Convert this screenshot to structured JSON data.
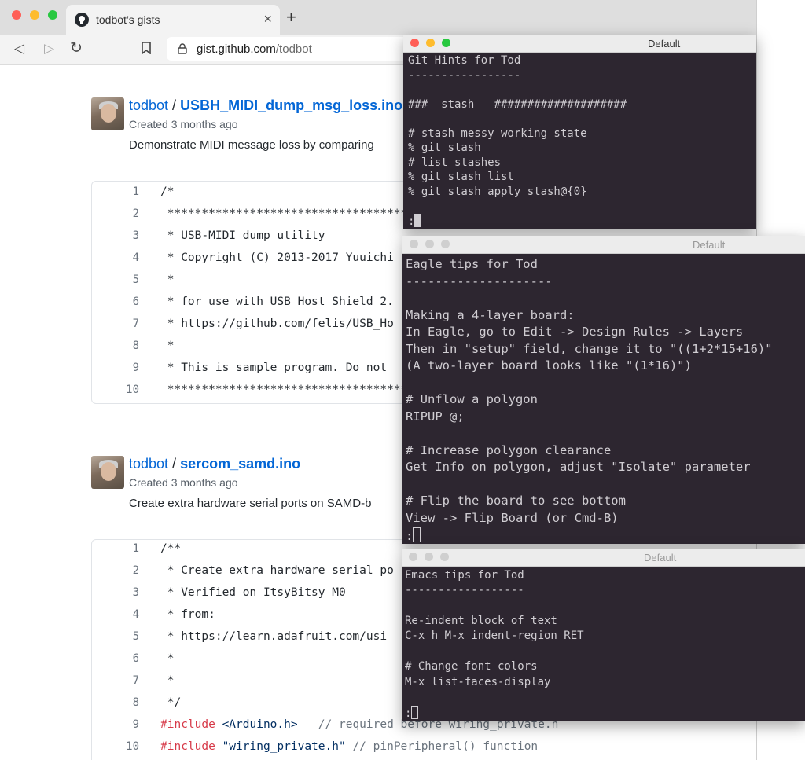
{
  "browser": {
    "tab_title": "todbot’s gists",
    "tab_close": "×",
    "new_tab": "+",
    "url_host": "gist.github.com",
    "url_path": "/todbot",
    "nav": {
      "back": "◁",
      "forward": "▷",
      "reload": "↻"
    }
  },
  "gists": [
    {
      "owner": "todbot",
      "sep": " / ",
      "name": "USBH_MIDI_dump_msg_loss.ino",
      "created": "Created 3 months ago",
      "description": "Demonstrate MIDI message loss by comparing",
      "lines": [
        {
          "n": "1",
          "text": "/*"
        },
        {
          "n": "2",
          "text": " *******************************************"
        },
        {
          "n": "3",
          "text": " * USB-MIDI dump utility"
        },
        {
          "n": "4",
          "text": " * Copyright (C) 2013-2017 Yuuichi"
        },
        {
          "n": "5",
          "text": " *"
        },
        {
          "n": "6",
          "text": " * for use with USB Host Shield 2."
        },
        {
          "n": "7",
          "text": " * https://github.com/felis/USB_Ho"
        },
        {
          "n": "8",
          "text": " *"
        },
        {
          "n": "9",
          "text": " * This is sample program. Do not"
        },
        {
          "n": "10",
          "text": " *******************************************"
        }
      ]
    },
    {
      "owner": "todbot",
      "sep": " / ",
      "name": "sercom_samd.ino",
      "created": "Created 3 months ago",
      "description": "Create extra hardware serial ports on SAMD-b",
      "lines": [
        {
          "n": "1",
          "text": "/**"
        },
        {
          "n": "2",
          "text": " * Create extra hardware serial po"
        },
        {
          "n": "3",
          "text": " * Verified on ItsyBitsy M0"
        },
        {
          "n": "4",
          "text": " * from:"
        },
        {
          "n": "5",
          "text": " * https://learn.adafruit.com/usi"
        },
        {
          "n": "6",
          "text": " *"
        },
        {
          "n": "7",
          "text": " *"
        },
        {
          "n": "8",
          "text": " */"
        },
        {
          "n": "9",
          "kw": "#include",
          "str": " <Arduino.h>",
          "cm": "   // required before wiring_private.h"
        },
        {
          "n": "10",
          "kw": "#include",
          "str": " \"wiring_private.h\"",
          "cm": " // pinPeripheral() function"
        }
      ]
    }
  ],
  "terminals": [
    {
      "title": "Default",
      "lines": [
        "Git Hints for Tod",
        "-----------------",
        "",
        "###  stash   ####################",
        "",
        "# stash messy working state",
        "% git stash",
        "# list stashes",
        "% git stash list",
        "% git stash apply stash@{0}",
        "",
        ":"
      ]
    },
    {
      "title": "Default",
      "lines": [
        "Eagle tips for Tod",
        "--------------------",
        "",
        "Making a 4-layer board:",
        "In Eagle, go to Edit -> Design Rules -> Layers",
        "Then in \"setup\" field, change it to \"((1+2*15+16)\"",
        "(A two-layer board looks like \"(1*16)\")",
        "",
        "# Unflow a polygon",
        "RIPUP @;",
        "",
        "# Increase polygon clearance",
        "Get Info on polygon, adjust \"Isolate\" parameter",
        "",
        "# Flip the board to see bottom",
        "View -> Flip Board (or Cmd-B)",
        ":"
      ]
    },
    {
      "title": "Default",
      "lines": [
        "Emacs tips for Tod",
        "------------------",
        "",
        "Re-indent block of text",
        "C-x h M-x indent-region RET",
        "",
        "# Change font colors",
        "M-x list-faces-display",
        "",
        ":"
      ]
    }
  ],
  "colors": {
    "link": "#0366d6",
    "terminal_bg": "#2d2630",
    "terminal_fg": "#d0cdd2",
    "traffic_red": "#ff5f57",
    "traffic_yellow": "#febc2e",
    "traffic_green": "#28c840"
  }
}
